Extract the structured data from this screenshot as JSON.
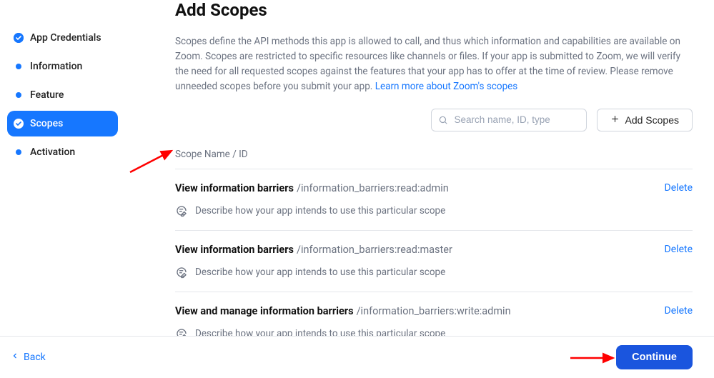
{
  "sidebar": {
    "items": [
      {
        "label": "App Credentials",
        "state": "done"
      },
      {
        "label": "Information",
        "state": "pending"
      },
      {
        "label": "Feature",
        "state": "pending"
      },
      {
        "label": "Scopes",
        "state": "active"
      },
      {
        "label": "Activation",
        "state": "pending"
      }
    ]
  },
  "page": {
    "title": "Add Scopes",
    "intro_a": "Scopes define the API methods this app is allowed to call, and thus which information and capabilities are available on Zoom. Scopes are restricted to specific resources like channels or files. If your app is submitted to Zoom, we will verify the need for all requested scopes against the features that your app has to offer at the time of review. Please remove unneeded scopes before you submit your app. ",
    "learn_more": "Learn more about Zoom's scopes"
  },
  "controls": {
    "search_placeholder": "Search name, ID, type",
    "add_button": "Add Scopes"
  },
  "table": {
    "header": "Scope Name / ID",
    "delete_label": "Delete",
    "rows": [
      {
        "name": "View information barriers",
        "id": "/information_barriers:read:admin",
        "desc": "Describe how your app intends to use this particular scope"
      },
      {
        "name": "View information barriers",
        "id": "/information_barriers:read:master",
        "desc": "Describe how your app intends to use this particular scope"
      },
      {
        "name": "View and manage information barriers",
        "id": "/information_barriers:write:admin",
        "desc": "Describe how your app intends to use this particular scope"
      }
    ]
  },
  "footer": {
    "back": "Back",
    "continue": "Continue"
  }
}
